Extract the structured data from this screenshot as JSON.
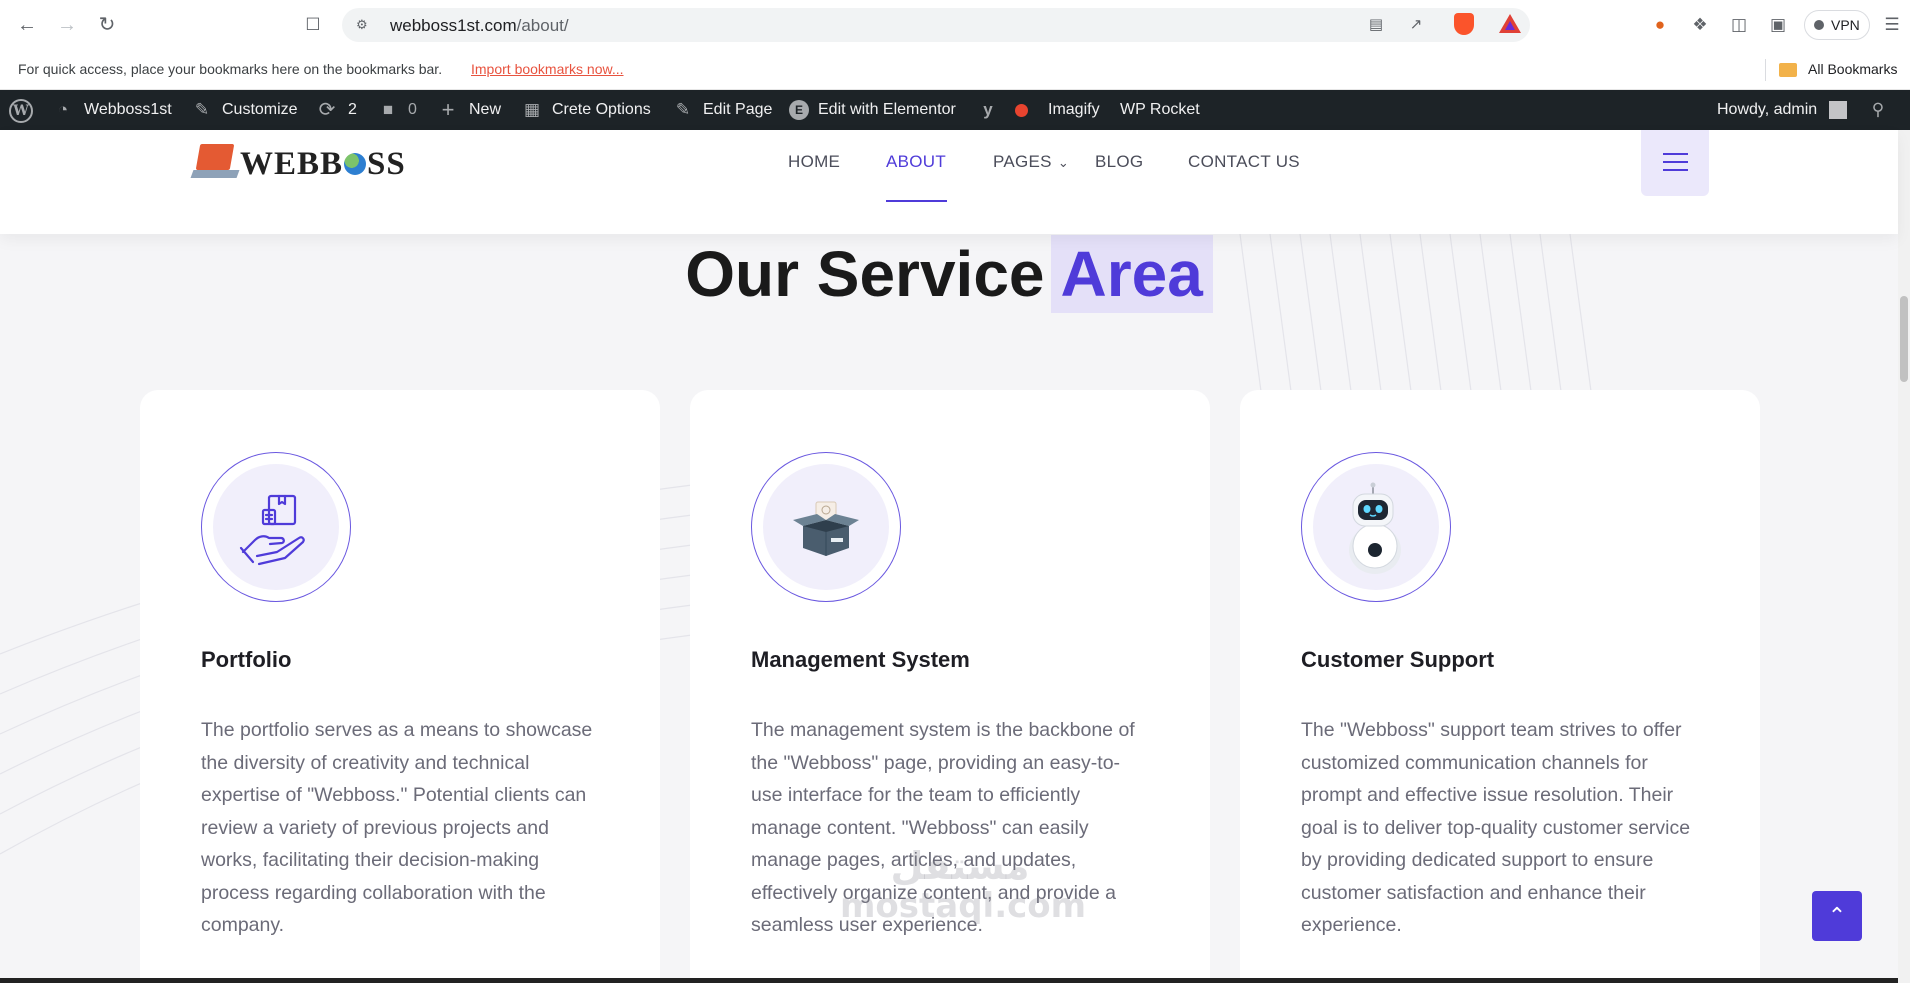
{
  "browser": {
    "url_domain": "webboss1st.com",
    "url_path": "/about/",
    "bookmarks_hint": "For quick access, place your bookmarks here on the bookmarks bar.",
    "import_link": "Import bookmarks now...",
    "all_bookmarks": "All Bookmarks",
    "vpn_label": "VPN"
  },
  "wp_admin_bar": {
    "site_name": "Webboss1st",
    "customize": "Customize",
    "updates_count": "2",
    "comments_count": "0",
    "new": "New",
    "crete_options": "Crete Options",
    "edit_page": "Edit Page",
    "edit_elementor": "Edit with Elementor",
    "imagify": "Imagify",
    "wp_rocket": "WP Rocket",
    "howdy": "Howdy, admin"
  },
  "site": {
    "logo_pre": "WEBB",
    "logo_post": "SS",
    "menu": [
      {
        "label": "HOME"
      },
      {
        "label": "ABOUT"
      },
      {
        "label": "PAGES"
      },
      {
        "label": "BLOG"
      },
      {
        "label": "CONTACT US"
      }
    ]
  },
  "section": {
    "title_main": "Our Service",
    "title_highlight": "Area"
  },
  "cards": [
    {
      "title": "Portfolio",
      "text": "The portfolio serves as a means to showcase the diversity of creativity and technical expertise of \"Webboss.\" Potential clients can review a variety of previous projects and works, facilitating their decision-making process regarding collaboration with the company."
    },
    {
      "title": "Management System",
      "text": " The management system is the backbone of the \"Webboss\" page, providing an easy-to-use interface for the team to efficiently manage content. \"Webboss\" can easily manage pages, articles, and updates, effectively organize content, and provide a seamless user experience."
    },
    {
      "title": "Customer Support",
      "text": "The \"Webboss\" support team strives to offer customized communication channels for prompt and effective issue resolution. Their goal is to deliver top-quality customer service by providing dedicated support to ensure customer satisfaction and enhance their experience."
    }
  ],
  "watermark": {
    "arabic": "مستقل",
    "latin": "mostaql.com"
  },
  "colors": {
    "accent": "#4f3bd9",
    "accent_light": "#e4e0f8",
    "admin_bar": "#1d2327"
  }
}
